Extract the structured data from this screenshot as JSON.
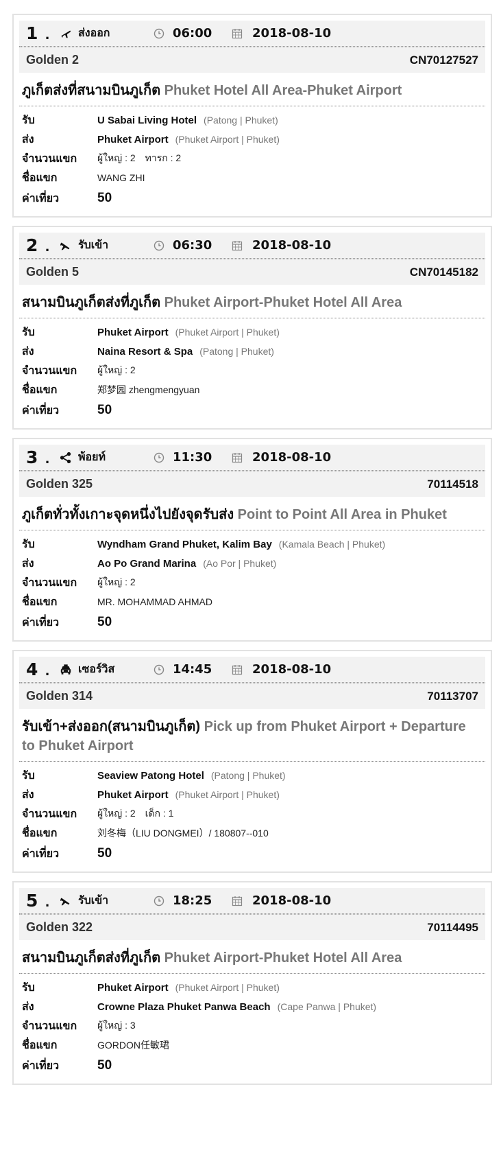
{
  "labels": {
    "pickup": "รับ",
    "dropoff": "ส่ง",
    "guests": "จำนวนแขก",
    "guest_name": "ชื่อแขก",
    "fare": "ค่าเที่ยว"
  },
  "jobs": [
    {
      "number": "1",
      "service_icon": "plane-takeoff-icon",
      "service": "ส่งออก",
      "time": "06:00",
      "date": "2018-08-10",
      "car": "Golden 2",
      "code": "CN70127527",
      "route_th": "ภูเก็ตส่งที่สนามบินภูเก็ต",
      "route_en": "Phuket Hotel All Area-Phuket Airport",
      "pickup_name": "U Sabai Living Hotel",
      "pickup_loc": "(Patong | Phuket)",
      "dropoff_name": "Phuket Airport",
      "dropoff_loc": "(Phuket Airport | Phuket)",
      "pax1": "ผู้ใหญ่ : 2",
      "pax2": "ทารก : 2",
      "guest": "WANG ZHI",
      "fare": "50"
    },
    {
      "number": "2",
      "service_icon": "plane-landing-icon",
      "service": "รับเข้า",
      "time": "06:30",
      "date": "2018-08-10",
      "car": "Golden 5",
      "code": "CN70145182",
      "route_th": "สนามบินภูเก็ตส่งที่ภูเก็ต",
      "route_en": "Phuket Airport-Phuket Hotel All Area",
      "pickup_name": "Phuket Airport",
      "pickup_loc": "(Phuket Airport | Phuket)",
      "dropoff_name": "Naina Resort & Spa",
      "dropoff_loc": "(Patong | Phuket)",
      "pax1": "ผู้ใหญ่ : 2",
      "pax2": "",
      "guest": "郑梦园 zhengmengyuan",
      "fare": "50"
    },
    {
      "number": "3",
      "service_icon": "share-icon",
      "service": "พ้อยท์",
      "time": "11:30",
      "date": "2018-08-10",
      "car": "Golden 325",
      "code": "70114518",
      "route_th": "ภูเก็ตทั่วทั้งเกาะจุดหนึ่งไปยังจุดรับส่ง",
      "route_en": "Point to Point All Area in Phuket",
      "pickup_name": "Wyndham Grand Phuket, Kalim Bay",
      "pickup_loc": "(Kamala Beach | Phuket)",
      "dropoff_name": "Ao Po Grand Marina",
      "dropoff_loc": "(Ao Por | Phuket)",
      "pax1": "ผู้ใหญ่ : 2",
      "pax2": "",
      "guest": "MR. MOHAMMAD AHMAD",
      "fare": "50"
    },
    {
      "number": "4",
      "service_icon": "taxi-icon",
      "service": "เซอร์วิส",
      "time": "14:45",
      "date": "2018-08-10",
      "car": "Golden 314",
      "code": "70113707",
      "route_th": "รับเข้า+ส่งออก(สนามบินภูเก็ต)",
      "route_en": "Pick up from Phuket Airport + Departure to Phuket Airport",
      "pickup_name": "Seaview Patong Hotel",
      "pickup_loc": "(Patong | Phuket)",
      "dropoff_name": "Phuket Airport",
      "dropoff_loc": "(Phuket Airport | Phuket)",
      "pax1": "ผู้ใหญ่ : 2",
      "pax2": "เด็ก : 1",
      "guest": "刘冬梅（LIU DONGMEI）/ 180807--010",
      "fare": "50"
    },
    {
      "number": "5",
      "service_icon": "plane-landing-icon",
      "service": "รับเข้า",
      "time": "18:25",
      "date": "2018-08-10",
      "car": "Golden 322",
      "code": "70114495",
      "route_th": "สนามบินภูเก็ตส่งที่ภูเก็ต",
      "route_en": "Phuket Airport-Phuket Hotel All Area",
      "pickup_name": "Phuket Airport",
      "pickup_loc": "(Phuket Airport | Phuket)",
      "dropoff_name": "Crowne Plaza Phuket Panwa Beach",
      "dropoff_loc": "(Cape Panwa | Phuket)",
      "pax1": "ผู้ใหญ่ : 3",
      "pax2": "",
      "guest": "GORDON任敏珺",
      "fare": "50"
    }
  ]
}
